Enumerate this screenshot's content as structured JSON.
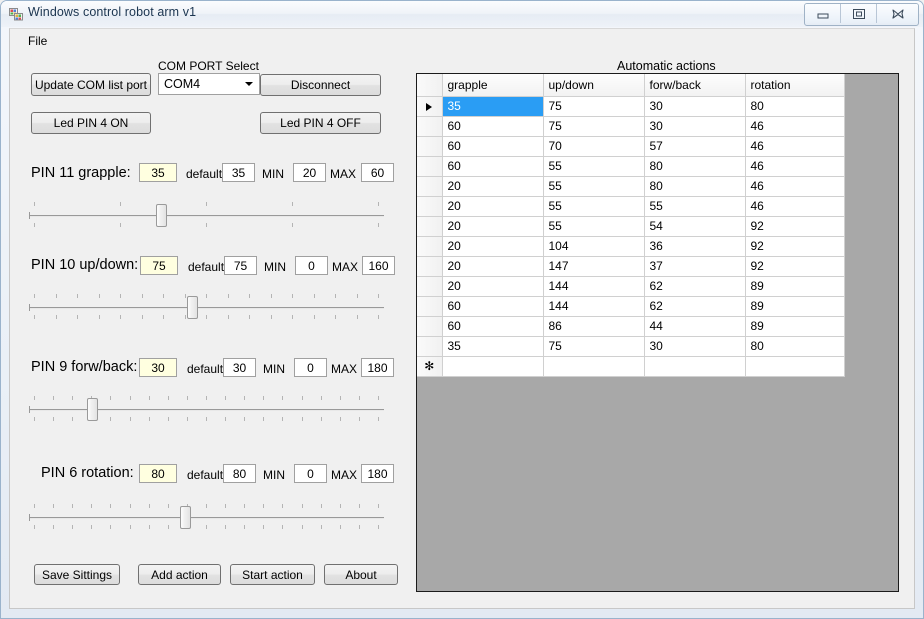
{
  "window": {
    "title": "Windows control robot arm v1",
    "icon": "app-icon",
    "buttons": {
      "minimize": "minimize-icon",
      "maximize": "maximize-icon",
      "close": "close-icon"
    }
  },
  "menu": {
    "items": [
      {
        "label": "File"
      }
    ]
  },
  "connection": {
    "update_button": "Update COM list port",
    "com_label": "COM PORT Select",
    "com_value": "COM4",
    "disconnect_button": "Disconnect",
    "led_on_button": "Led PIN 4 ON",
    "led_off_button": "Led PIN 4 OFF"
  },
  "axes": [
    {
      "name": "PIN 11 grapple:",
      "value": "35",
      "default_label": "default",
      "default_value": "35",
      "min_label": "MIN",
      "min_value": "20",
      "max_label": "MAX",
      "max_value": "60",
      "ticks": 5,
      "thumb_percent": 37
    },
    {
      "name": "PIN 10 up/down:",
      "value": "75",
      "default_label": "default",
      "default_value": "75",
      "min_label": "MIN",
      "min_value": "0",
      "max_label": "MAX",
      "max_value": "160",
      "ticks": 17,
      "thumb_percent": 46
    },
    {
      "name": "PIN 9 forw/back:",
      "value": "30",
      "default_label": "default",
      "default_value": "30",
      "min_label": "MIN",
      "min_value": "0",
      "max_label": "MAX",
      "max_value": "180",
      "ticks": 19,
      "thumb_percent": 17
    },
    {
      "name": "PIN 6 rotation:",
      "value": "80",
      "default_label": "default",
      "default_value": "80",
      "min_label": "MIN",
      "min_value": "0",
      "max_label": "MAX",
      "max_value": "180",
      "ticks": 19,
      "thumb_percent": 44
    }
  ],
  "actions_bar": {
    "save": "Save Sittings",
    "add": "Add action",
    "start": "Start action",
    "about": "About"
  },
  "grid": {
    "title": "Automatic actions",
    "columns": [
      "grapple",
      "up/down",
      "forw/back",
      "rotation"
    ],
    "selected_cell": {
      "row": 0,
      "col": 0
    },
    "row_marker_current": "▶",
    "row_marker_new": "✻",
    "rows": [
      [
        "35",
        "75",
        "30",
        "80"
      ],
      [
        "60",
        "75",
        "30",
        "46"
      ],
      [
        "60",
        "70",
        "57",
        "46"
      ],
      [
        "60",
        "55",
        "80",
        "46"
      ],
      [
        "20",
        "55",
        "80",
        "46"
      ],
      [
        "20",
        "55",
        "55",
        "46"
      ],
      [
        "20",
        "55",
        "54",
        "92"
      ],
      [
        "20",
        "104",
        "36",
        "92"
      ],
      [
        "20",
        "147",
        "37",
        "92"
      ],
      [
        "20",
        "144",
        "62",
        "89"
      ],
      [
        "60",
        "144",
        "62",
        "89"
      ],
      [
        "60",
        "86",
        "44",
        "89"
      ],
      [
        "35",
        "75",
        "30",
        "80"
      ],
      [
        "",
        "",
        "",
        ""
      ]
    ]
  },
  "colors": {
    "selection": "#2a9df4",
    "grid_background": "#a8a8a8",
    "current_value_field": "#ffffe0",
    "form_background": "#f0f0f0"
  }
}
